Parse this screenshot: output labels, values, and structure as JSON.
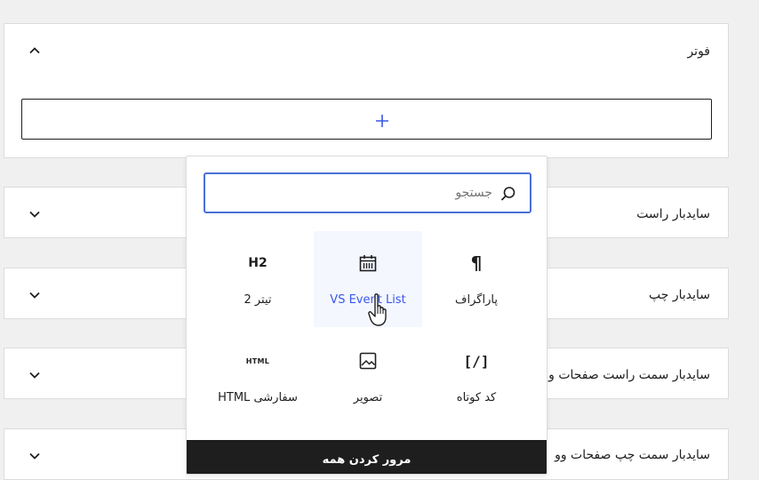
{
  "panels": [
    {
      "title": "فوتر",
      "expanded": true
    },
    {
      "title": "سایدبار راست",
      "expanded": false
    },
    {
      "title": "سایدبار چپ",
      "expanded": false
    },
    {
      "title": "سایدبار سمت راست صفحات و",
      "expanded": false
    },
    {
      "title": "سایدبار سمت چپ صفحات وو",
      "expanded": false
    }
  ],
  "inserter": {
    "search_placeholder": "جستجو",
    "blocks": [
      {
        "label": "پاراگراف",
        "icon": "paragraph-icon",
        "glyph": "¶"
      },
      {
        "label": "VS Event List",
        "icon": "calendar-icon"
      },
      {
        "label": "تیتر 2",
        "icon": "heading-icon",
        "glyph": "H2"
      },
      {
        "label": "کد کوتاه",
        "icon": "shortcode-icon",
        "glyph": "[/]"
      },
      {
        "label": "تصویر",
        "icon": "image-icon"
      },
      {
        "label": "HTML سفارشی",
        "icon": "html-icon",
        "glyph": "HTML"
      }
    ],
    "browse_all_label": "مرور کردن همه"
  },
  "colors": {
    "accent": "#3858e9",
    "focus_border": "#4a6fd8",
    "footer_bar": "#1e1e1e"
  }
}
